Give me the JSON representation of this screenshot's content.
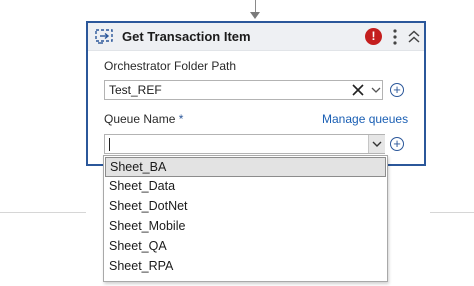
{
  "activity": {
    "title": "Get Transaction Item",
    "icon": "transaction-item-icon",
    "error_icon_text": "!",
    "menu_icon": "more-vertical-icon",
    "collapse_icon": "collapse-up-icon"
  },
  "folder_field": {
    "label": "Orchestrator Folder Path",
    "value": "Test_REF"
  },
  "queue_field": {
    "label": "Queue Name",
    "required_marker": "*",
    "value": "",
    "manage_link": "Manage queues"
  },
  "dropdown": {
    "options": [
      "Sheet_BA",
      "Sheet_Data",
      "Sheet_DotNet",
      "Sheet_Mobile",
      "Sheet_QA",
      "Sheet_RPA"
    ],
    "highlighted_index": 0
  },
  "colors": {
    "accent": "#2b579a",
    "link": "#1a5fb4",
    "error": "#c41e1e",
    "header_bg": "#eef0f3"
  }
}
